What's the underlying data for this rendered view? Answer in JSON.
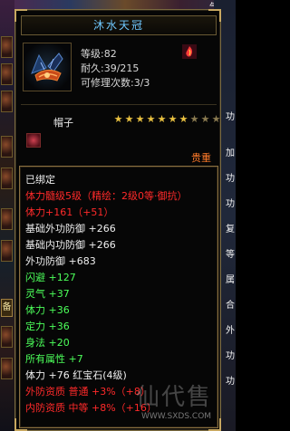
{
  "background": {
    "top_label": "气",
    "left_tab": "备",
    "right_chars": [
      "功",
      "加",
      "功",
      "功",
      "复",
      "等",
      "属",
      "合",
      "外",
      "功",
      "功"
    ]
  },
  "item": {
    "name": "沐水天冠",
    "level": "等级:82",
    "durability": "耐久:39/215",
    "repairs": "可修理次数:3/3",
    "category": "帽子",
    "stars_total": 10,
    "stars_lit": 7,
    "quality": "贵重"
  },
  "properties": [
    {
      "text": "已绑定",
      "color": "#efefef"
    },
    {
      "text": "体力髓级5级（精绘：2级0等·御抗）",
      "color": "#ff2a2a"
    },
    {
      "text": "体力+161（+51）",
      "color": "#ff2a2a"
    },
    {
      "text": "基础外功防御 +266",
      "color": "#efefef"
    },
    {
      "text": "基础内功防御 +266",
      "color": "#efefef"
    },
    {
      "text": "外功防御 +683",
      "color": "#efefef"
    },
    {
      "text": "闪避 +127",
      "color": "#4cff5a"
    },
    {
      "text": "灵气 +37",
      "color": "#4cff5a"
    },
    {
      "text": "体力 +36",
      "color": "#4cff5a"
    },
    {
      "text": "定力 +36",
      "color": "#4cff5a"
    },
    {
      "text": "身法 +20",
      "color": "#4cff5a"
    },
    {
      "text": "所有属性 +7",
      "color": "#4cff5a"
    },
    {
      "text": "体力 +76 红宝石(4级)",
      "color": "#efefef"
    },
    {
      "text": "外防资质 普通 +3%（+8）",
      "color": "#ff2a2a"
    },
    {
      "text": "内防资质 中等 +8%（+16）",
      "color": "#ff2a2a"
    }
  ],
  "watermark": {
    "brand": "仙代售",
    "url": "WWW.SXDS.COM"
  },
  "colors": {
    "title": "#6fc8ff",
    "frame": "#8a7040",
    "quality": "#ff7a2a",
    "star": "#e8c040"
  }
}
